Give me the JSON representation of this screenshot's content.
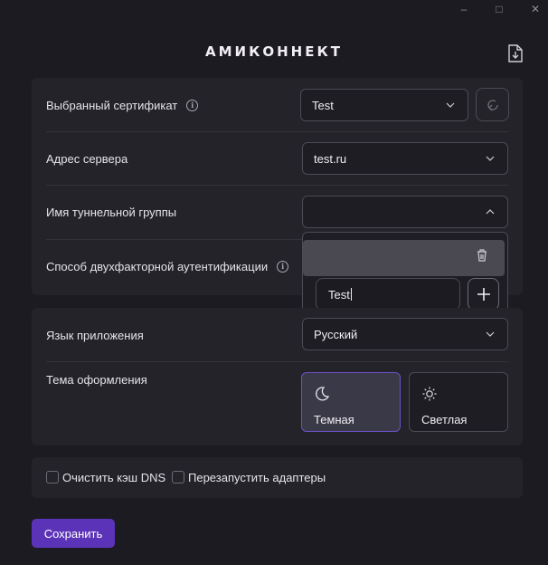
{
  "app": {
    "title": "АМИКОННЕКТ"
  },
  "window": {
    "minimize_label": "–",
    "maximize_label": "□",
    "close_label": "✕"
  },
  "form": {
    "certificate": {
      "label": "Выбранный сертификат",
      "value": "Test"
    },
    "server": {
      "label": "Адрес сервера",
      "value": "test.ru"
    },
    "tunnel_group": {
      "label": "Имя туннельной группы",
      "value": "",
      "dropdown": {
        "new_item_value": "Test"
      }
    },
    "two_factor": {
      "label": "Способ двухфакторной аутентификации"
    }
  },
  "settings": {
    "language": {
      "label": "Язык приложения",
      "value": "Русский"
    },
    "theme": {
      "label": "Тема оформления",
      "options": [
        {
          "label": "Темная",
          "icon": "moon-icon",
          "selected": true
        },
        {
          "label": "Светлая",
          "icon": "sun-icon",
          "selected": false
        }
      ]
    }
  },
  "options": {
    "clear_dns": {
      "label": "Очистить кэш DNS",
      "checked": false
    },
    "restart_adapters": {
      "label": "Перезапустить адаптеры",
      "checked": false
    }
  },
  "actions": {
    "save_label": "Сохранить"
  },
  "colors": {
    "accent": "#5b33b8",
    "background": "#1c1b21",
    "card": "#242329",
    "active_border": "#6b52c8"
  }
}
